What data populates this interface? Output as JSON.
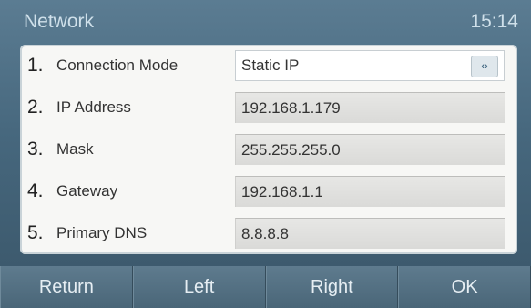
{
  "header": {
    "title": "Network",
    "time": "15:14"
  },
  "rows": [
    {
      "num": "1.",
      "label": "Connection Mode",
      "value": "Static IP",
      "toggle": "‹›"
    },
    {
      "num": "2.",
      "label": "IP Address",
      "value": "192.168.1.179"
    },
    {
      "num": "3.",
      "label": "Mask",
      "value": "255.255.255.0"
    },
    {
      "num": "4.",
      "label": "Gateway",
      "value": "192.168.1.1"
    },
    {
      "num": "5.",
      "label": "Primary DNS",
      "value": "8.8.8.8"
    }
  ],
  "softkeys": [
    "Return",
    "Left",
    "Right",
    "OK"
  ]
}
